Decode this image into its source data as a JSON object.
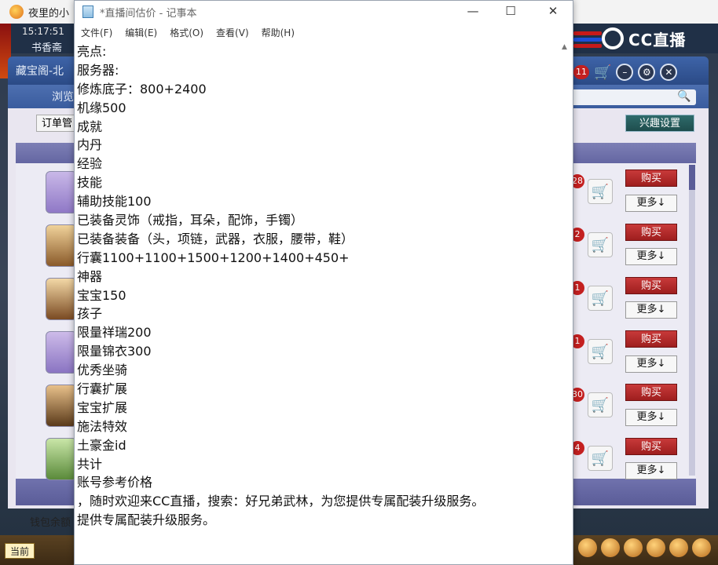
{
  "background_app": {
    "window_title": "夜里的小",
    "hud_time": "15:17:51",
    "hud_location": "书香斋",
    "logo_text": "CC直播",
    "shop": {
      "title": "藏宝阁-北",
      "browse_label": "浏览",
      "order_button": "订单管",
      "interest_button": "兴趣设置",
      "header_badge": "11",
      "wallet_label": "钱包余额",
      "bottom_now": "当前",
      "rows": [
        {
          "num": "28",
          "buy": "购买",
          "more": "更多↓"
        },
        {
          "num": "2",
          "buy": "购买",
          "more": "更多↓"
        },
        {
          "num": "1",
          "buy": "购买",
          "more": "更多↓"
        },
        {
          "num": "1",
          "buy": "购买",
          "more": "更多↓"
        },
        {
          "num": "30",
          "buy": "购买",
          "more": "更多↓"
        },
        {
          "num": "4",
          "buy": "购买",
          "more": "更多↓"
        }
      ]
    }
  },
  "notepad": {
    "title": "*直播间估价 - 记事本",
    "menu": [
      "文件(F)",
      "编辑(E)",
      "格式(O)",
      "查看(V)",
      "帮助(H)"
    ],
    "lines": [
      "亮点:",
      "服务器:",
      "修炼底子：800+2400",
      "机缘500",
      "成就",
      "内丹",
      "经验",
      "技能",
      "辅助技能100",
      "已装备灵饰（戒指，耳朵，配饰，手镯）",
      "已装备装备（头，项链，武器，衣服，腰带，鞋）",
      "行囊1100+1100+1500+1200+1400+450+",
      "神器",
      "宝宝150",
      "孩子",
      "限量祥瑞200",
      "限量锦衣300",
      "优秀坐骑",
      "行囊扩展",
      "宝宝扩展",
      "施法特效",
      "土豪金id",
      "共计",
      "账号参考价格",
      "，随时欢迎来CC直播，搜索：好兄弟武林，为您提供专属配装升级服务。",
      "提供专属配装升级服务。"
    ]
  },
  "colors": {
    "buy_button": "#b02828",
    "panel_blue": "#2b4a86",
    "list_purple": "#6466a2"
  }
}
